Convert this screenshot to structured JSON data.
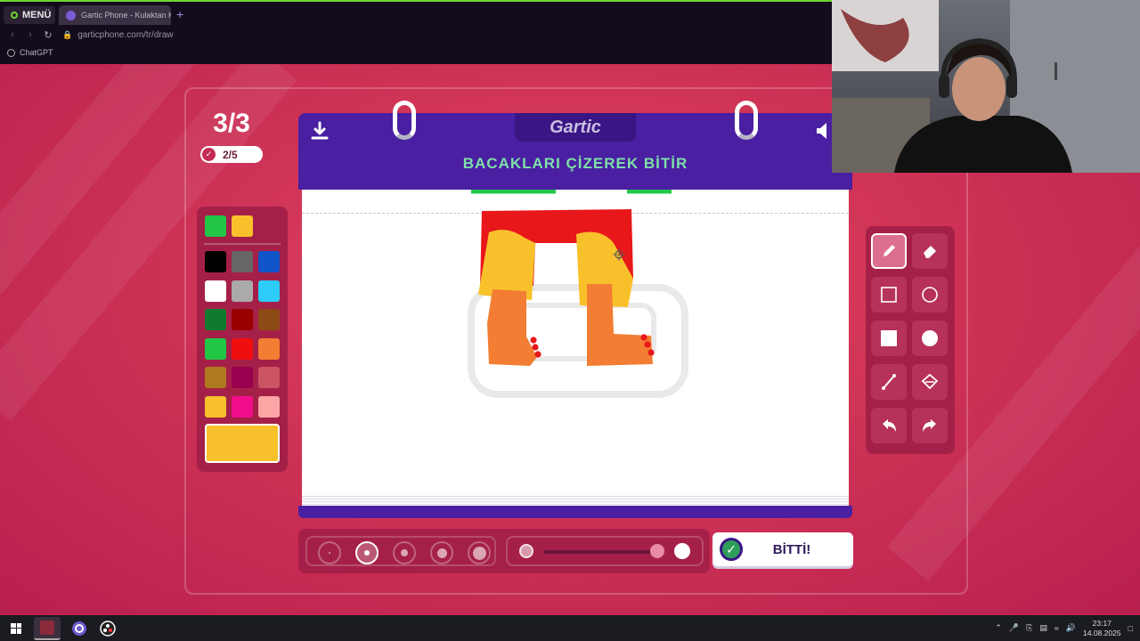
{
  "browser": {
    "menu_label": "MENÜ",
    "tab_title": "Gartic Phone - Kulaktan K",
    "new_tab": "+",
    "url": "garticphone.com/tr/draw",
    "bookmark": "ChatGPT"
  },
  "game": {
    "round": "3/3",
    "players_done": "2/5",
    "logo": "Gartic",
    "prompt": "BACAKLARI ÇİZEREK BİTİR",
    "done_button": "BİTTİ!",
    "selected_color": "#F8C12C",
    "recent_colors": [
      "#22C748",
      "#F8C12C"
    ],
    "palette": [
      "#000000",
      "#666666",
      "#1055C9",
      "#FFFFFF",
      "#AAAAAA",
      "#2BCCF7",
      "#0F7B2E",
      "#990000",
      "#8E4A14",
      "#22C748",
      "#F00F0F",
      "#F37D32",
      "#AE7A1E",
      "#99004E",
      "#CB5462",
      "#F8C12C",
      "#F20E8A",
      "#FBA5A5"
    ],
    "tools": [
      "pencil-icon",
      "eraser-icon",
      "rectangle-outline-icon",
      "ellipse-outline-icon",
      "rectangle-filled-icon",
      "ellipse-filled-icon",
      "line-icon",
      "fill-bucket-icon",
      "undo-icon",
      "redo-icon"
    ],
    "active_tool": "pencil",
    "brush_sizes": 5,
    "active_brush_size": 2
  },
  "taskbar": {
    "time": "23:17",
    "date": "14.08.2025"
  }
}
